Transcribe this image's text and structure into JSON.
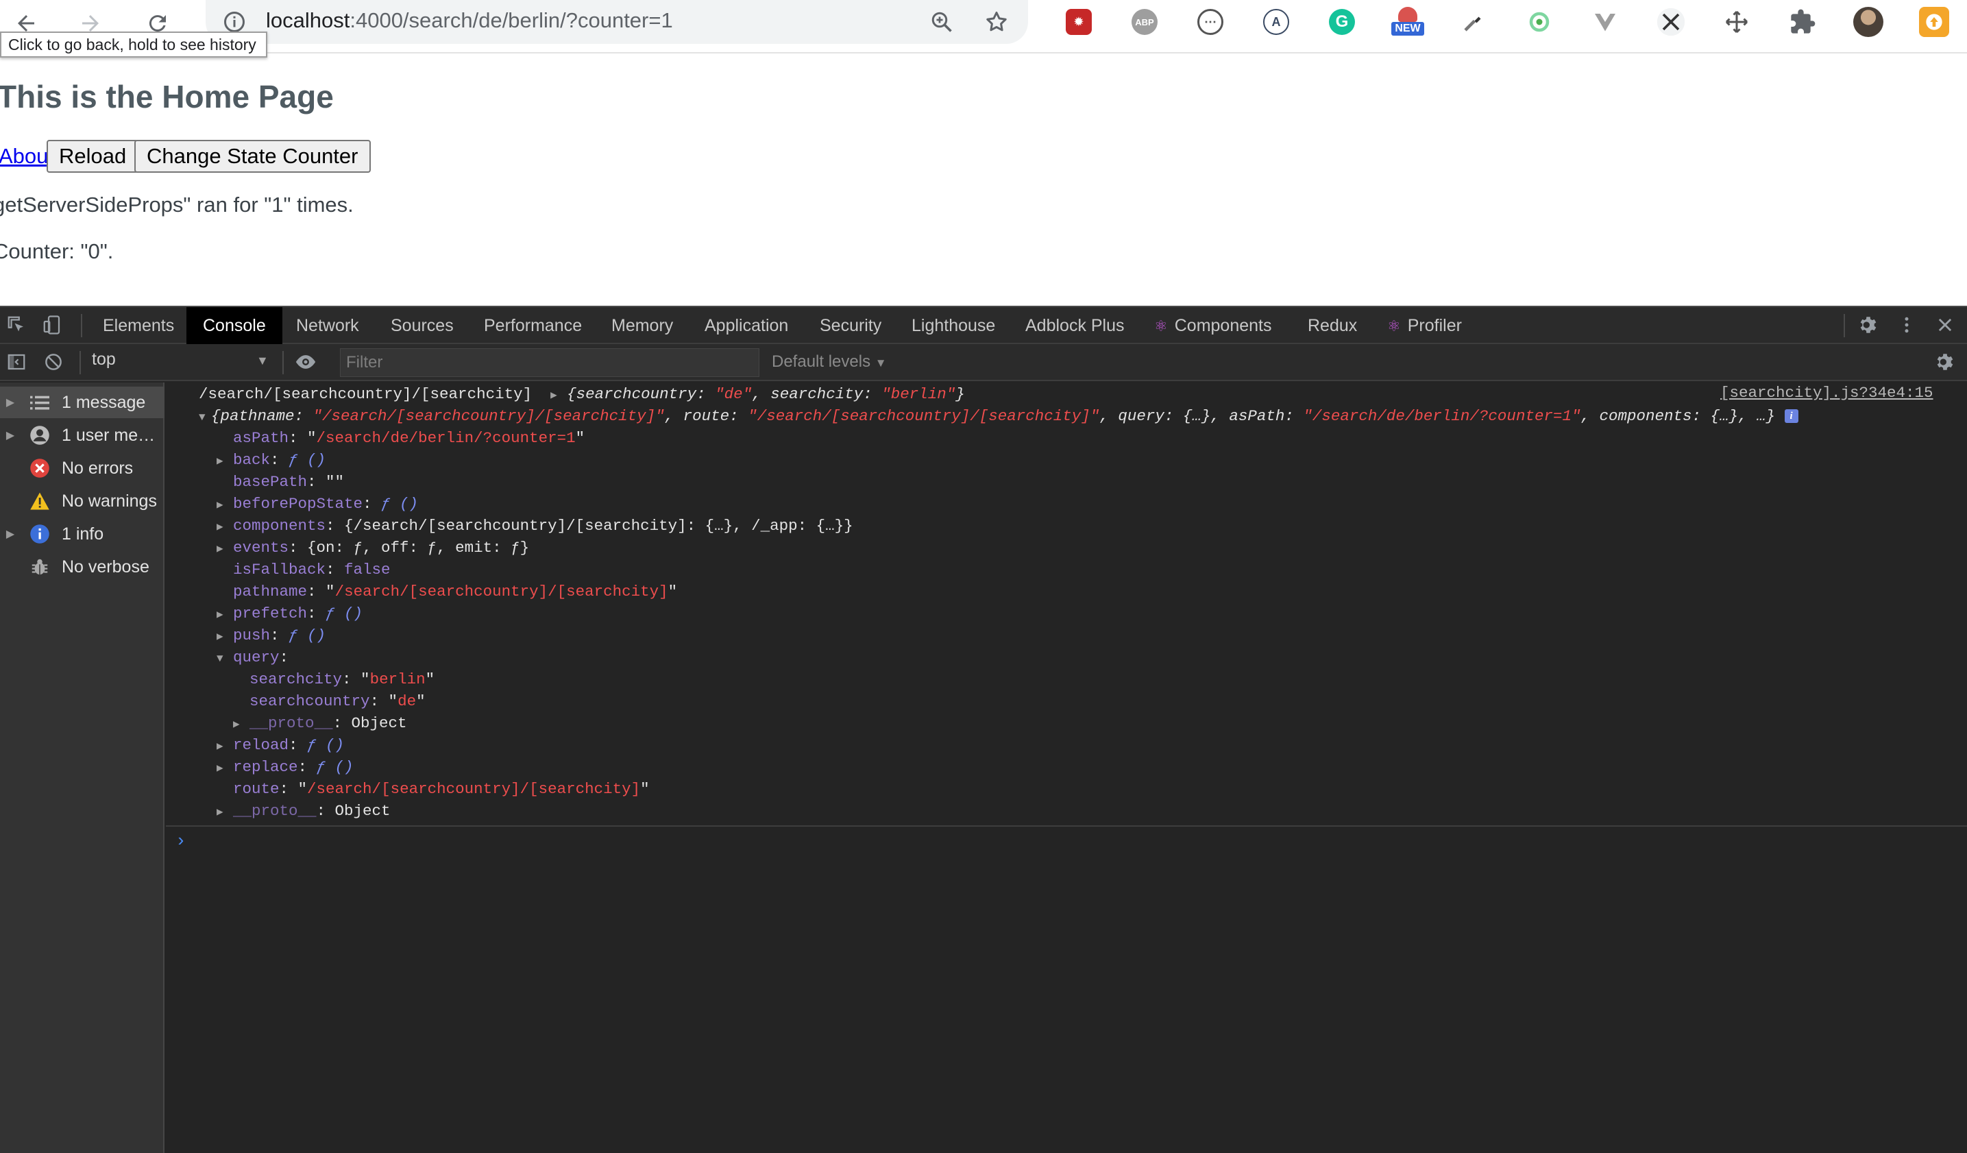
{
  "browser": {
    "url_host": "localhost",
    "url_path": ":4000/search/de/berlin/?counter=1",
    "tooltip": "Click to go back, hold to see history",
    "extensions": [
      "react-devtools-ext",
      "abp-ext",
      "dots-ext",
      "a-ext",
      "grammarly-ext",
      "new-badge-ext",
      "eyedropper-ext",
      "circle-ext",
      "vue-ext",
      "cross-ext",
      "move-ext",
      "puzzle-ext",
      "avatar",
      "upload-ext"
    ],
    "ext_labels": {
      "abp": "ABP",
      "new": "NEW",
      "grammarly": "G",
      "a": "A"
    }
  },
  "page": {
    "title": "This is the Home Page",
    "about_link": "About",
    "reload_button": "Reload",
    "change_button": "Change State Counter",
    "server_props_text": "getServerSideProps\" ran for \"1\" times.",
    "counter_text": "Counter: \"0\"."
  },
  "devtools": {
    "tabs": [
      "Elements",
      "Console",
      "Network",
      "Sources",
      "Performance",
      "Memory",
      "Application",
      "Security",
      "Lighthouse",
      "Adblock Plus",
      "Components",
      "Redux",
      "Profiler"
    ],
    "active_tab": "Console",
    "context": "top",
    "filter_placeholder": "Filter",
    "levels": "Default levels",
    "sidebar": [
      {
        "label": "1 message",
        "icon": "list-icon"
      },
      {
        "label": "1 user mes…",
        "icon": "user-icon"
      },
      {
        "label": "No errors",
        "icon": "error-icon"
      },
      {
        "label": "No warnings",
        "icon": "warning-icon"
      },
      {
        "label": "1 info",
        "icon": "info-icon"
      },
      {
        "label": "No verbose",
        "icon": "bug-icon"
      }
    ],
    "console": {
      "source_link": "[searchcity].js?34e4:15",
      "log_path": "/search/[searchcountry]/[searchcity]",
      "lines": {
        "summary_searchcountry": "de",
        "summary_searchcity": "berlin",
        "pathname": "/search/[searchcountry]/[searchcity]",
        "route": "/search/[searchcountry]/[searchcity]",
        "asPath": "/search/de/berlin/?counter=1",
        "components_val": "{/search/[searchcountry]/[searchcity]: {…}, /_app: {…}}",
        "events_val": "{on: ƒ, off: ƒ, emit: ƒ}",
        "isFallback": "false",
        "query_searchcity": "berlin",
        "query_searchcountry": "de",
        "proto": "Object"
      }
    }
  }
}
